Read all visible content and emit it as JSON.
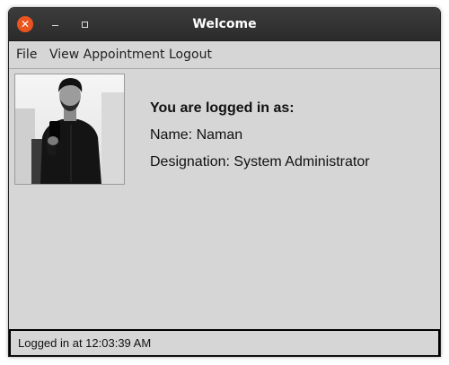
{
  "window": {
    "title": "Welcome",
    "close_glyph": "✕"
  },
  "menu": {
    "items": [
      {
        "label": "File"
      },
      {
        "label": "View Appointment"
      },
      {
        "label": "Logout"
      }
    ]
  },
  "profile": {
    "photo_icon": "user-photo",
    "heading": "You are logged in as:",
    "name": "Name: Naman",
    "designation": "Designation: System Administrator"
  },
  "status": {
    "text": "Logged in at 12:03:39 AM"
  },
  "colors": {
    "titlebar": "#2f2f2f",
    "close_button": "#e9541f",
    "window_bg": "#d6d6d6"
  }
}
